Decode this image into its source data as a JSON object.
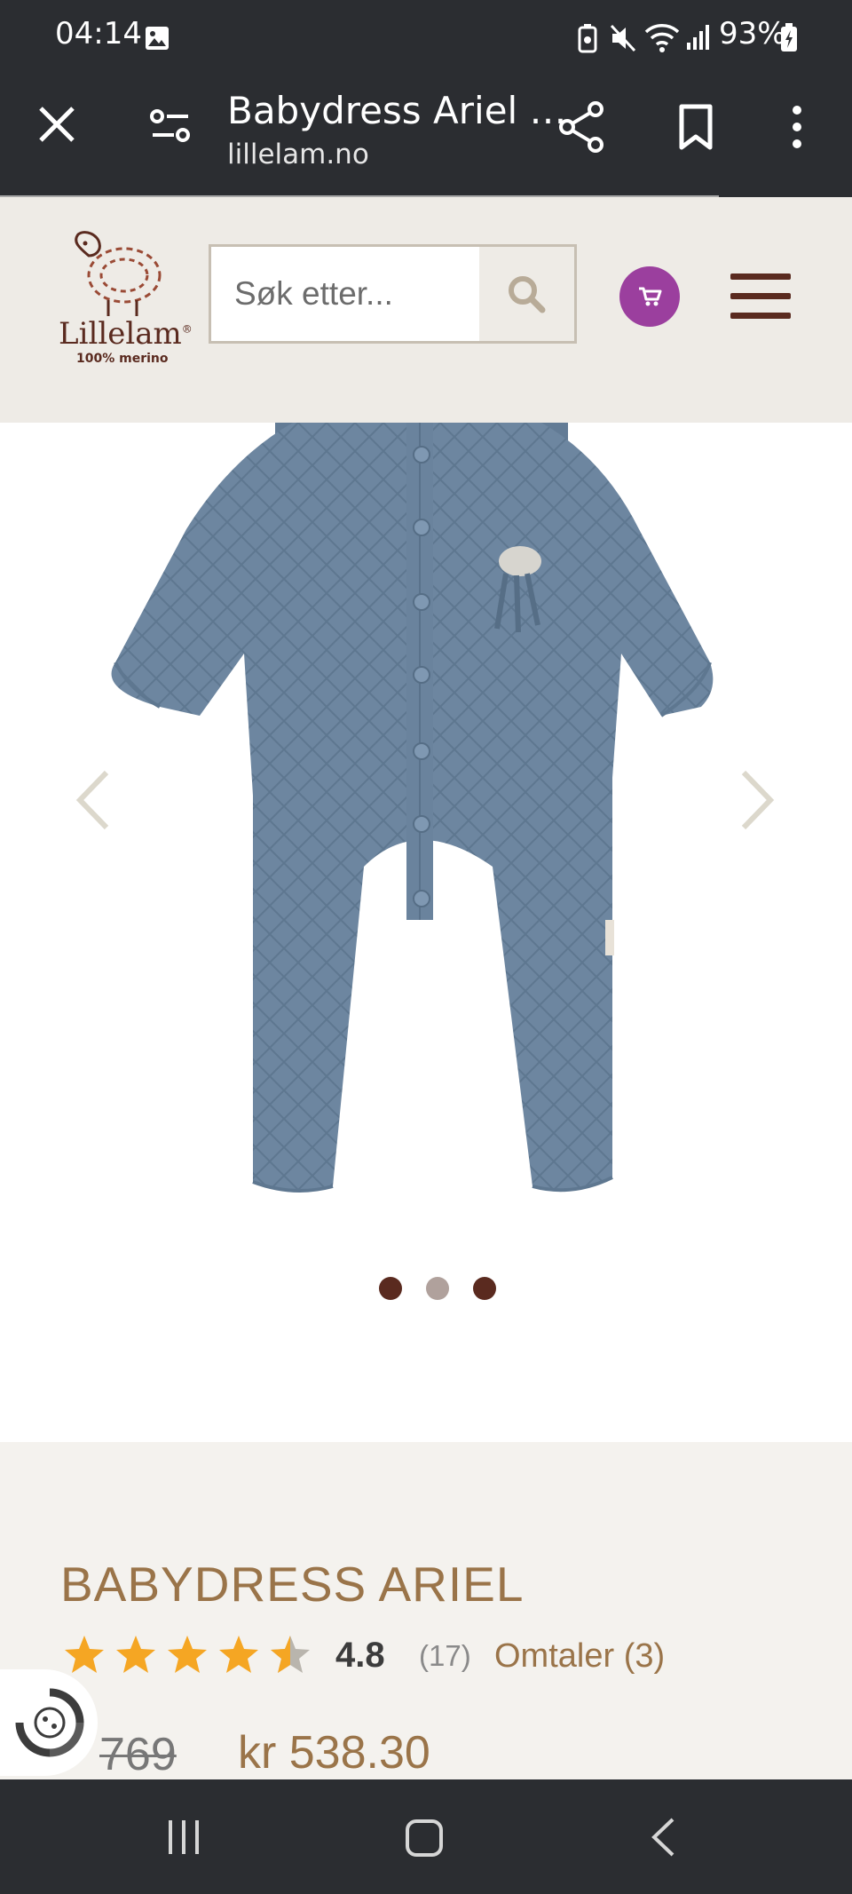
{
  "status_bar": {
    "time": "04:14",
    "battery": "93%"
  },
  "browser": {
    "title": "Babydress Ariel …",
    "url": "lillelam.no"
  },
  "site": {
    "logo_name": "Lillelam",
    "logo_tm": "®",
    "logo_tagline": "100% merino",
    "search_placeholder": "Søk etter..."
  },
  "product": {
    "title": "BABYDRESS ARIEL",
    "rating": "4.8",
    "rating_fraction": 0.96,
    "rating_count": "(17)",
    "reviews": "Omtaler (3)",
    "old_price": "769",
    "price": "kr 538.30",
    "image_count": 3,
    "active_image": 2
  },
  "colors": {
    "brand_brown": "#9a7449",
    "dark_brown": "#5a2a1f",
    "cart_purple": "#9b3f9e",
    "star_gold": "#f5a623",
    "garment_blue": "#6d86a0"
  }
}
